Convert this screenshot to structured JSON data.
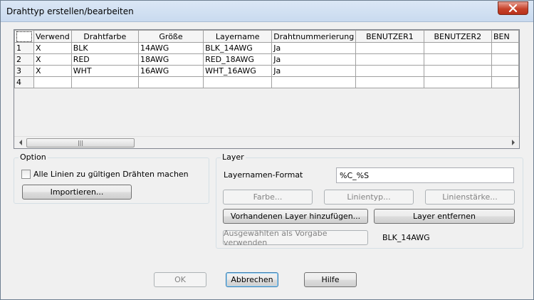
{
  "window": {
    "title": "Drahttyp erstellen/bearbeiten"
  },
  "grid": {
    "columns": [
      "Verwend",
      "Drahtfarbe",
      "Größe",
      "Layername",
      "Drahtnummerierung",
      "BENUTZER1",
      "BENUTZER2",
      "BEN"
    ],
    "rows": [
      {
        "num": "1",
        "cells": [
          "X",
          "BLK",
          "14AWG",
          "BLK_14AWG",
          "Ja",
          "",
          "",
          ""
        ]
      },
      {
        "num": "2",
        "cells": [
          "X",
          "RED",
          "18AWG",
          "RED_18AWG",
          "Ja",
          "",
          "",
          ""
        ]
      },
      {
        "num": "3",
        "cells": [
          "X",
          "WHT",
          "16AWG",
          "WHT_16AWG",
          "Ja",
          "",
          "",
          ""
        ]
      },
      {
        "num": "4",
        "cells": [
          "",
          "",
          "",
          "",
          "",
          "",
          "",
          ""
        ]
      }
    ],
    "scrollbar_grip": "|||"
  },
  "option": {
    "label": "Option",
    "checkbox_label": "Alle Linien zu gültigen Drähten machen",
    "checked": false,
    "import_button": "Importieren..."
  },
  "layer": {
    "label": "Layer",
    "format_label": "Layernamen-Format",
    "format_value": "%C_%S",
    "color_button": "Farbe...",
    "linetype_button": "Linientyp...",
    "lineweight_button": "Linienstärke...",
    "add_existing_button": "Vorhandenen Layer hinzufügen...",
    "remove_button": "Layer entfernen",
    "use_selected_button": "Ausgewählten als Vorgabe verwenden",
    "current_default": "BLK_14AWG"
  },
  "footer": {
    "ok": "OK",
    "cancel": "Abbrechen",
    "help": "Hilfe"
  }
}
